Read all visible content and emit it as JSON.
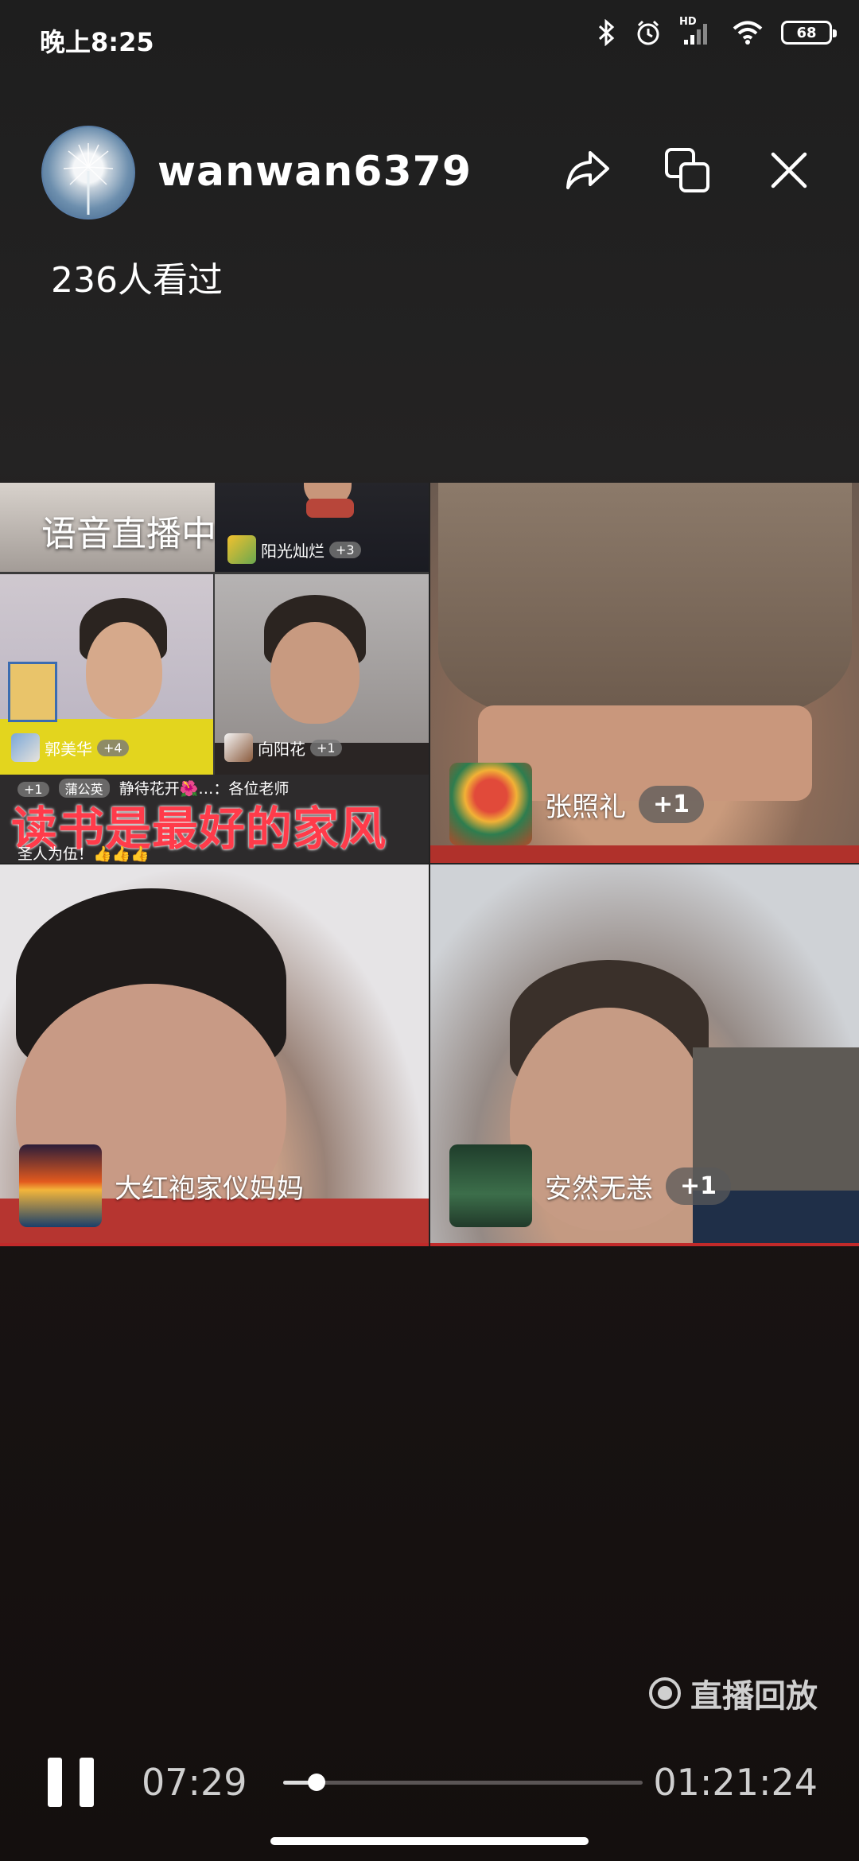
{
  "status": {
    "time": "晚上8:25",
    "battery": "68",
    "network": "HD"
  },
  "header": {
    "username": "wanwan6379",
    "viewers": "236人看过"
  },
  "tile1": {
    "live_label": "语音直播中",
    "guest_top": {
      "name": "阳光灿烂",
      "plus": "+3"
    },
    "guest_left": {
      "name": "郭美华",
      "plus": "+4"
    },
    "guest_right": {
      "name": "向阳花",
      "plus": "+1"
    },
    "chat_line1_chip": "+1",
    "chat_line1_user": "蒲公英",
    "chat_line1_text": "静待花开🌺…：各位老师",
    "chat_line2": "圣人为伍！👍👍👍",
    "banner": "读书是最好的家风"
  },
  "tile2": {
    "name": "张照礼",
    "plus": "+1"
  },
  "tile3": {
    "name": "大红袍家仪妈妈"
  },
  "tile4": {
    "name": "安然无恙",
    "plus": "+1"
  },
  "player": {
    "replay_label": "直播回放",
    "current_time": "07:29",
    "total_time": "01:21:24",
    "progress": 0.092
  },
  "colors": {
    "banner": "#ff3b4a",
    "accent_red": "#c12a2a"
  }
}
